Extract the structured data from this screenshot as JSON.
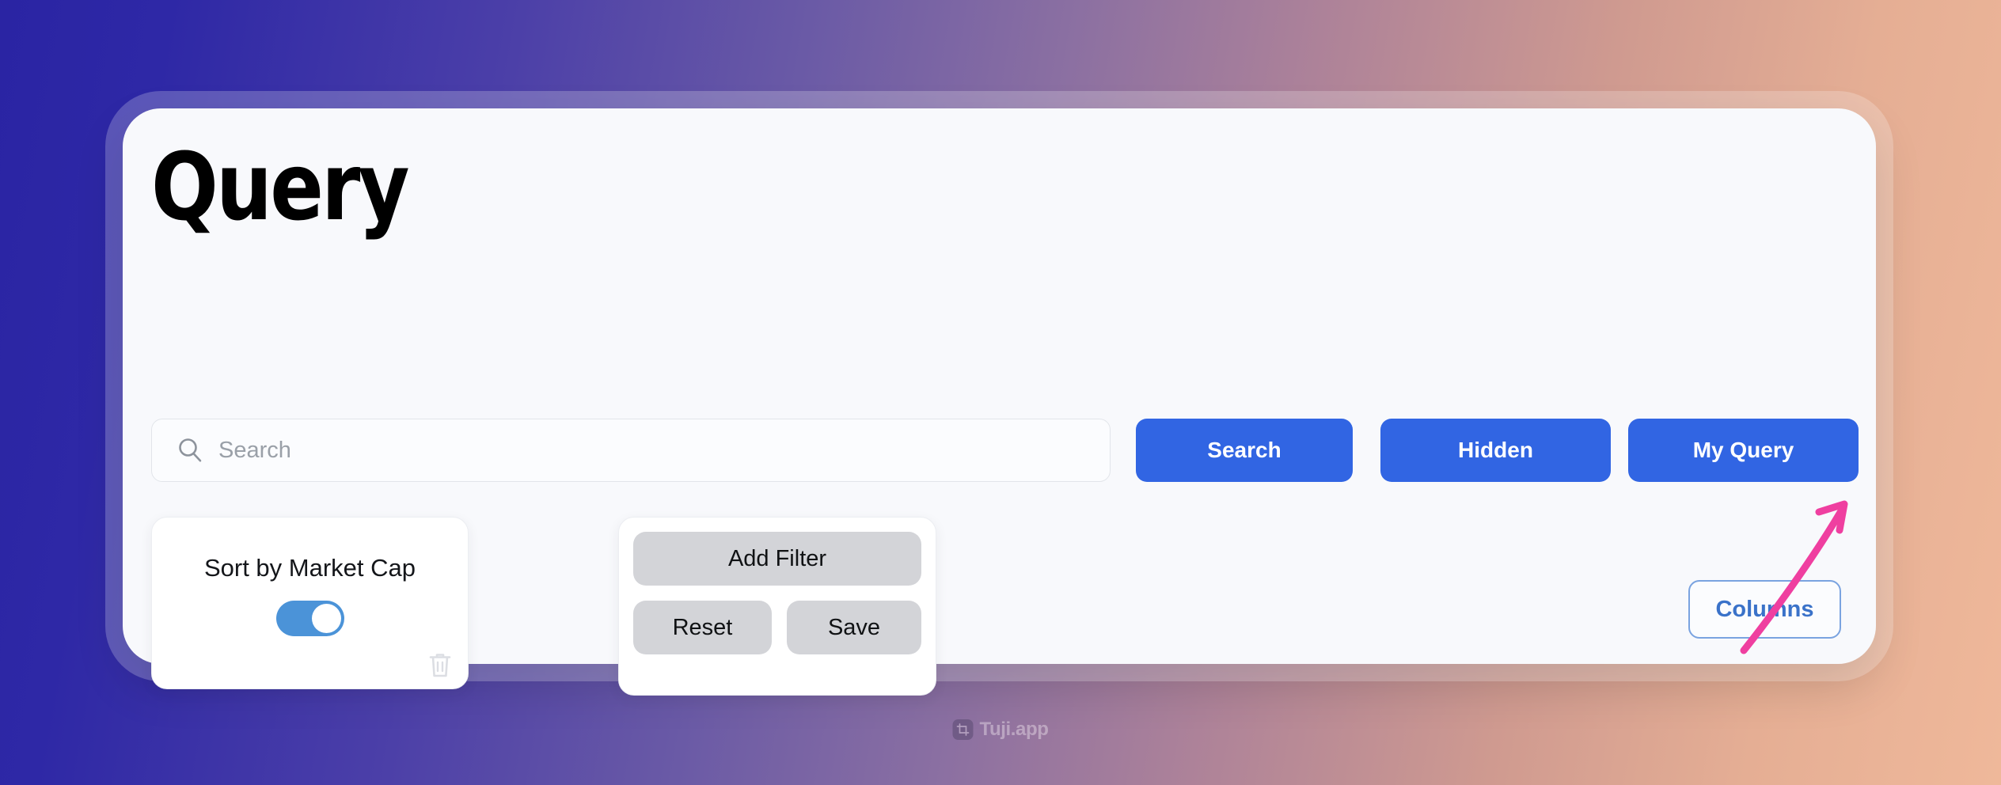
{
  "page": {
    "title": "Query"
  },
  "search": {
    "placeholder": "Search",
    "value": "",
    "icon": "search-icon"
  },
  "actions": {
    "search_label": "Search",
    "hidden_label": "Hidden",
    "my_query_label": "My Query"
  },
  "sort_card": {
    "label": "Sort by Market Cap",
    "toggle_state": "on",
    "delete_icon": "trash-icon"
  },
  "filter_card": {
    "add_filter_label": "Add Filter",
    "reset_label": "Reset",
    "save_label": "Save"
  },
  "footer": {
    "columns_label": "Columns"
  },
  "annotation": {
    "type": "arrow",
    "direction": "up-right",
    "points_to": "My Query",
    "color": "#ef3fa0"
  },
  "watermark": {
    "label": "Tuji.app",
    "icon": "crop-icon"
  },
  "colors": {
    "accent_blue": "#3165e3",
    "toggle_blue": "#4b93d8",
    "outline_blue": "#7aa3e0",
    "gray_button": "#d3d4d8",
    "card_bg": "#f8f9fc",
    "annotation_pink": "#ef3fa0",
    "bg_gradient_start": "#2a24a3",
    "bg_gradient_end": "#efb89a"
  }
}
